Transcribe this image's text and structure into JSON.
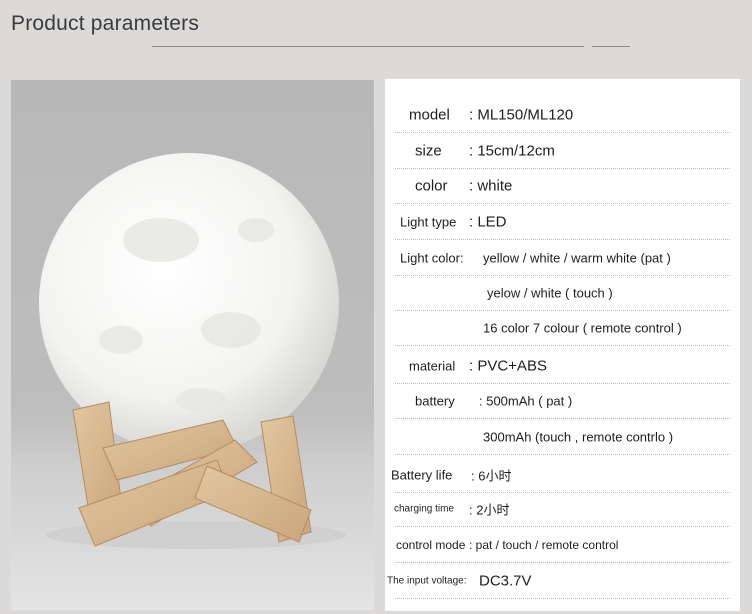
{
  "header": {
    "title": "Product parameters"
  },
  "rows": [
    {
      "label": "model",
      "value": ": ML150/ML120"
    },
    {
      "label": "size",
      "value": ": 15cm/12cm"
    },
    {
      "label": "color",
      "value": ":  white"
    },
    {
      "label": "Light type",
      "value": ": LED"
    },
    {
      "label": "Light color:",
      "value": " yellow  / white / warm white (pat )"
    },
    {
      "label": "",
      "value": "yelow / white ( touch )"
    },
    {
      "label": "",
      "value": "16 color 7 colour ( remote control )"
    },
    {
      "label": "material",
      "value": ": PVC+ABS"
    },
    {
      "label": "battery",
      "value": ":  500mAh ( pat )"
    },
    {
      "label": "",
      "value": "300mAh (touch  , remote contrlo )"
    },
    {
      "label": "Battery life",
      "value": ": 6小时"
    },
    {
      "label": "charging time",
      "value": ": 2小时"
    },
    {
      "label": "control mode",
      "value": ":  pat / touch / remote control"
    },
    {
      "label": "The input voltage:",
      "value": " DC3.7V"
    }
  ]
}
